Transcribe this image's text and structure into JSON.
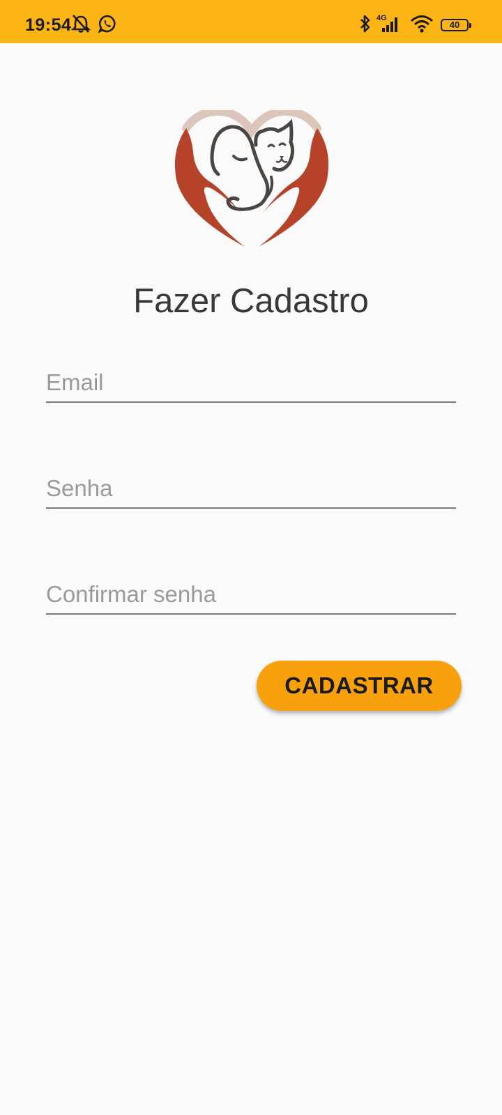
{
  "status_bar": {
    "time": "19:54",
    "network": "4G",
    "battery": "40",
    "icons": [
      "alarm-off-icon",
      "whatsapp-icon",
      "bluetooth-icon",
      "cellular-signal-icon",
      "wifi-icon",
      "battery-icon"
    ]
  },
  "logo": {
    "icon": "pet-heart-hands-logo",
    "colors": {
      "hands": "#b5432a",
      "arc": "#dcc5ba",
      "line": "#4a4540"
    }
  },
  "page": {
    "title": "Fazer Cadastro"
  },
  "form": {
    "email_placeholder": "Email",
    "password_placeholder": "Senha",
    "confirm_placeholder": "Confirmar senha",
    "submit_label": "CADASTRAR"
  },
  "colors": {
    "status_bar": "#fcb514",
    "button": "#f8a10c",
    "background": "#fafafa"
  }
}
